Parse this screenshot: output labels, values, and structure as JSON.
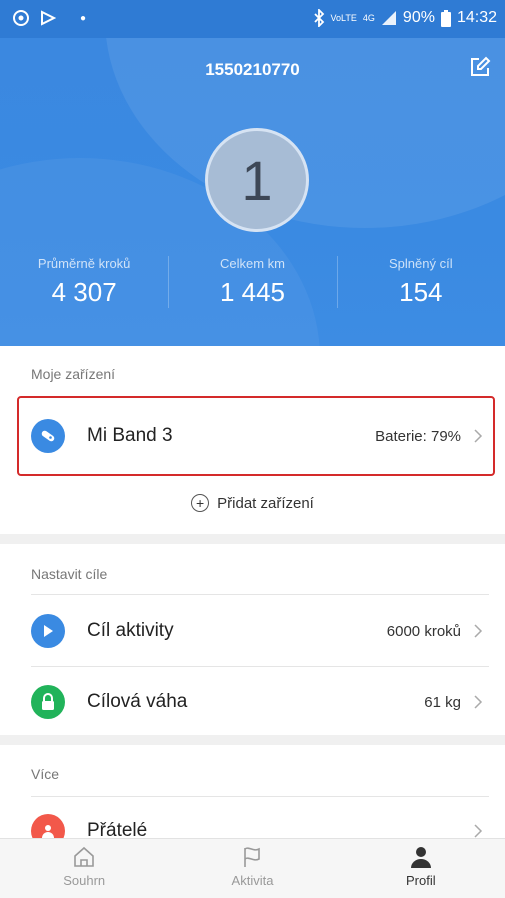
{
  "status_bar": {
    "battery": "90%",
    "time": "14:32",
    "network_volte": "VoLTE",
    "network_4g": "4G"
  },
  "header": {
    "user_id": "1550210770",
    "level": "1",
    "stats": [
      {
        "label": "Průměrně kroků",
        "value": "4 307"
      },
      {
        "label": "Celkem km",
        "value": "1 445"
      },
      {
        "label": "Splněný cíl",
        "value": "154"
      }
    ]
  },
  "devices": {
    "section_title": "Moje zařízení",
    "device_name": "Mi Band 3",
    "battery_text": "Baterie: 79%",
    "add_device_label": "Přidat zařízení"
  },
  "goals": {
    "section_title": "Nastavit cíle",
    "items": [
      {
        "label": "Cíl aktivity",
        "value": "6000 kroků",
        "icon": "flag-icon",
        "color": "#3a8ae2"
      },
      {
        "label": "Cílová váha",
        "value": "61 kg",
        "icon": "lock-icon",
        "color": "#21b35a"
      }
    ]
  },
  "more": {
    "section_title": "Více",
    "friends_label": "Přátelé",
    "friends_color": "#f2584a"
  },
  "tabbar": {
    "tabs": [
      {
        "label": "Souhrn",
        "icon": "home-icon"
      },
      {
        "label": "Aktivita",
        "icon": "flag-outline-icon"
      },
      {
        "label": "Profil",
        "icon": "person-icon"
      }
    ],
    "active": "Profil"
  },
  "colors": {
    "accent": "#3a8ae2",
    "highlight_border": "#d42a2a"
  }
}
